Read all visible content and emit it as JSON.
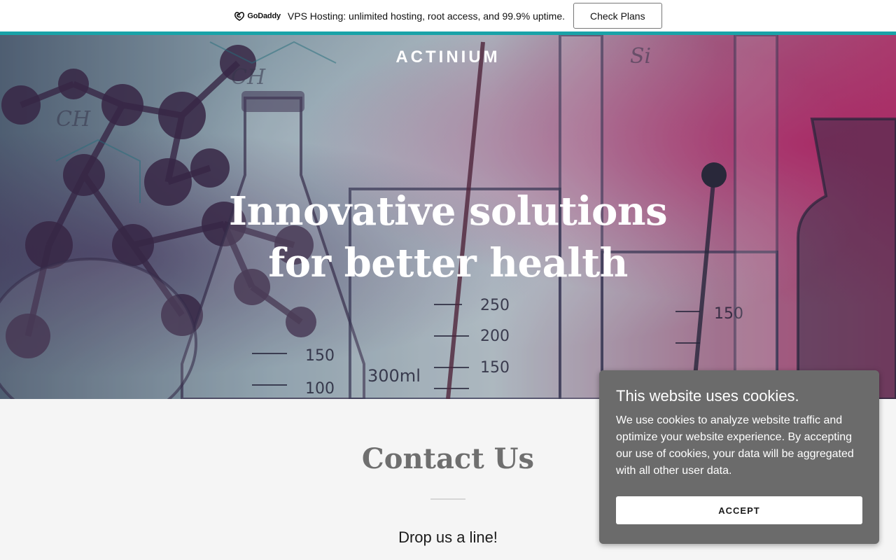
{
  "promo": {
    "logo_text": "GoDaddy",
    "logo_icon": "godaddy-logo-icon",
    "text": "VPS Hosting: unlimited hosting, root access, and 99.9% uptime.",
    "button_label": "Check Plans"
  },
  "hero": {
    "brand": "ACTINIUM",
    "headline": "Innovative solutions for better health"
  },
  "contact": {
    "title": "Contact Us",
    "subtitle": "Drop us a line!"
  },
  "cookie_banner": {
    "title": "This website uses cookies.",
    "body": "We use cookies to analyze website traffic and optimize your website experience. By accepting our use of cookies, your data will be aggregated with all other user data.",
    "accept_label": "ACCEPT"
  },
  "colors": {
    "accent_line": "#19a3a8",
    "cookie_bg": "#6b6b6b",
    "section_bg": "#f5f5f5"
  }
}
